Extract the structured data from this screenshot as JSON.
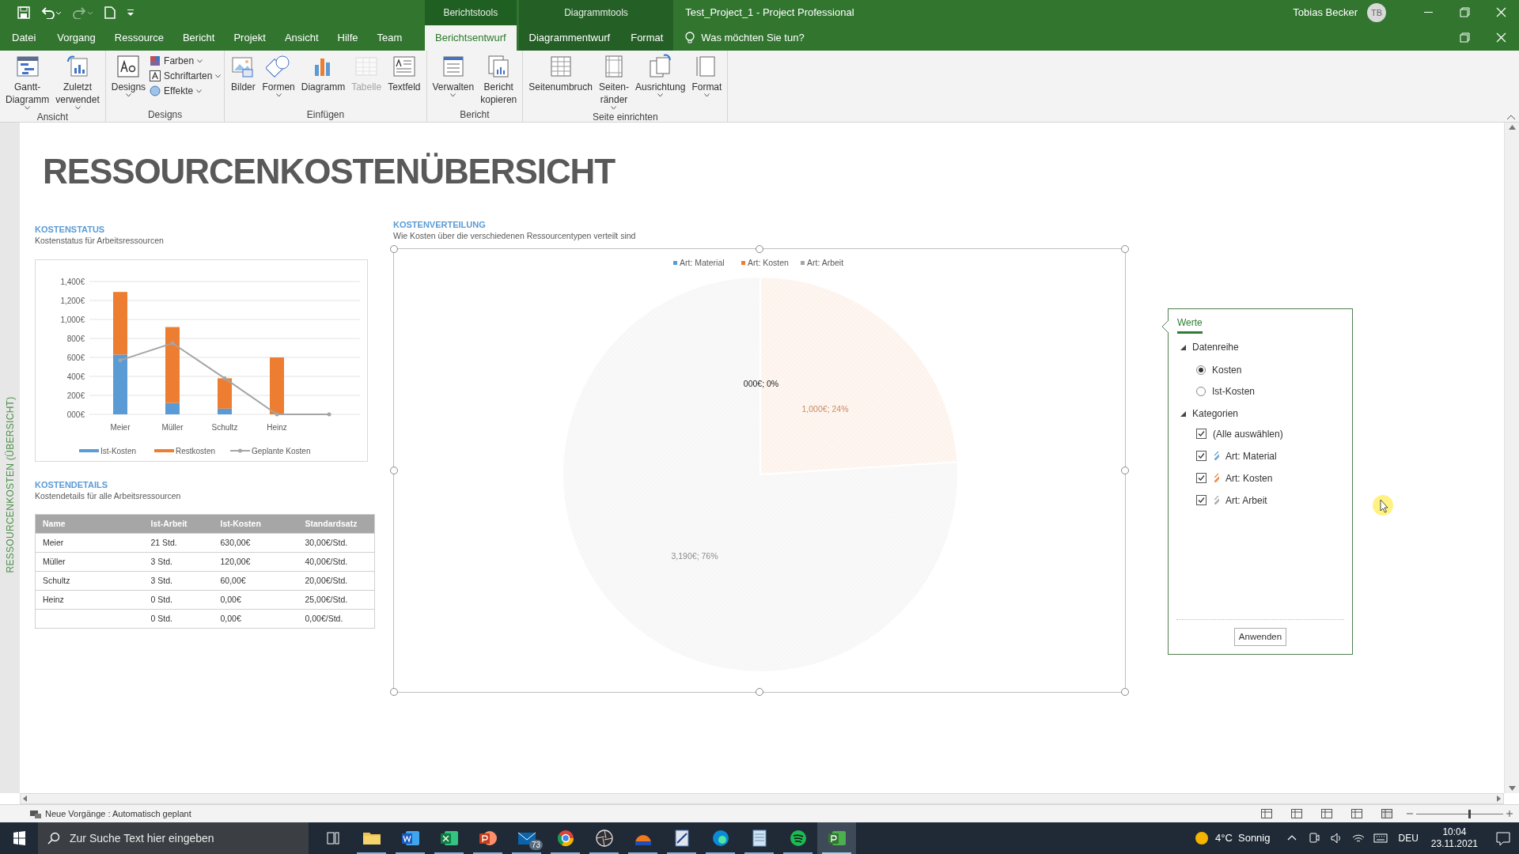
{
  "window": {
    "title": "Test_Project_1  -  Project Professional",
    "user": "Tobias Becker",
    "avatar": "TB"
  },
  "context_tabs": [
    {
      "label": "Berichtstools",
      "tabs": [
        {
          "label": "Berichtsentwurf",
          "selected": true
        }
      ]
    },
    {
      "label": "Diagrammtools",
      "tabs": [
        {
          "label": "Diagrammentwurf",
          "selected": false
        },
        {
          "label": "Format",
          "selected": false
        }
      ]
    }
  ],
  "tabs": [
    {
      "label": "Datei",
      "selected": false
    },
    {
      "label": "Vorgang",
      "selected": false
    },
    {
      "label": "Ressource",
      "selected": false
    },
    {
      "label": "Bericht",
      "selected": false
    },
    {
      "label": "Projekt",
      "selected": false
    },
    {
      "label": "Ansicht",
      "selected": false
    },
    {
      "label": "Hilfe",
      "selected": false
    },
    {
      "label": "Team",
      "selected": false
    }
  ],
  "tell_me": {
    "placeholder": "Was möchten Sie tun?"
  },
  "ribbon": [
    {
      "label": "Ansicht",
      "buttons": [
        {
          "kind": "large",
          "label": "Gantt-\nDiagramm",
          "dropdown": true,
          "disabled": false
        },
        {
          "kind": "large",
          "label": "Zuletzt\nverwendet",
          "dropdown": true,
          "disabled": false
        }
      ]
    },
    {
      "label": "Designs",
      "buttons": [
        {
          "kind": "large",
          "label": "Designs",
          "dropdown": true,
          "disabled": false
        },
        {
          "kind": "small",
          "label": "Farben",
          "dropdown": true,
          "disabled": false
        },
        {
          "kind": "small",
          "label": "Schriftarten",
          "dropdown": true,
          "disabled": false
        },
        {
          "kind": "small",
          "label": "Effekte",
          "dropdown": true,
          "disabled": false
        }
      ]
    },
    {
      "label": "Einfügen",
      "buttons": [
        {
          "kind": "large",
          "label": "Bilder",
          "dropdown": false,
          "disabled": false
        },
        {
          "kind": "large",
          "label": "Formen",
          "dropdown": true,
          "disabled": false
        },
        {
          "kind": "large",
          "label": "Diagramm",
          "dropdown": false,
          "disabled": false
        },
        {
          "kind": "large",
          "label": "Tabelle",
          "dropdown": false,
          "disabled": true
        },
        {
          "kind": "large",
          "label": "Textfeld",
          "dropdown": false,
          "disabled": false
        }
      ]
    },
    {
      "label": "Bericht",
      "buttons": [
        {
          "kind": "large",
          "label": "Verwalten",
          "dropdown": true,
          "disabled": false
        },
        {
          "kind": "large",
          "label": "Bericht\nkopieren",
          "dropdown": false,
          "disabled": false
        }
      ]
    },
    {
      "label": "Seite einrichten",
      "buttons": [
        {
          "kind": "large",
          "label": "Seitenumbruch",
          "dropdown": false,
          "disabled": false
        },
        {
          "kind": "large",
          "label": "Seiten-\nränder",
          "dropdown": true,
          "disabled": false
        },
        {
          "kind": "large",
          "label": "Ausrichtung",
          "dropdown": true,
          "disabled": false
        },
        {
          "kind": "large",
          "label": "Format",
          "dropdown": true,
          "disabled": false
        }
      ]
    }
  ],
  "report": {
    "side_label": "RESSOURCENKOSTEN (ÜBERSICHT)",
    "title": "RESSOURCENKOSTENÜBERSICHT",
    "cost_status": {
      "heading": "KOSTENSTATUS",
      "subtitle": "Kostenstatus für Arbeitsressourcen",
      "chart_data": {
        "type": "bar",
        "stacked": true,
        "categories": [
          "Meier",
          "Müller",
          "Schultz",
          "Heinz",
          null
        ],
        "series": [
          {
            "name": "Ist-Kosten",
            "type": "bar",
            "color": "#5b9bd5",
            "values": [
              630,
              120,
              60,
              0,
              0
            ]
          },
          {
            "name": "Restkosten",
            "type": "bar",
            "color": "#ed7d31",
            "values": [
              660,
              800,
              320,
              600,
              0
            ]
          },
          {
            "name": "Geplante Kosten",
            "type": "line",
            "color": "#a5a5a5",
            "values": [
              570,
              750,
              380,
              0,
              0
            ]
          }
        ],
        "ylim": [
          0,
          1400
        ],
        "grid": true,
        "legend": "bottom",
        "yticks": [
          {
            "value": 0,
            "label": "000€"
          },
          {
            "value": 200,
            "label": "200€"
          },
          {
            "value": 400,
            "label": "400€"
          },
          {
            "value": 600,
            "label": "600€"
          },
          {
            "value": 800,
            "label": "800€"
          },
          {
            "value": 1000,
            "label": "1,000€"
          },
          {
            "value": 1200,
            "label": "1,200€"
          },
          {
            "value": 1400,
            "label": "1,400€"
          }
        ]
      }
    },
    "cost_details": {
      "heading": "KOSTENDETAILS",
      "subtitle": "Kostendetails für alle Arbeitsressourcen",
      "columns": [
        "Name",
        "Ist-Arbeit",
        "Ist-Kosten",
        "Standardsatz"
      ],
      "rows": [
        [
          "Meier",
          "21 Std.",
          "630,00€",
          "30,00€/Std."
        ],
        [
          "Müller",
          "3 Std.",
          "120,00€",
          "40,00€/Std."
        ],
        [
          "Schultz",
          "3 Std.",
          "60,00€",
          "20,00€/Std."
        ],
        [
          "Heinz",
          "0 Std.",
          "0,00€",
          "25,00€/Std."
        ],
        [
          null,
          "0 Std.",
          "0,00€",
          "0,00€/Std."
        ]
      ]
    },
    "cost_distribution": {
      "heading": "KOSTENVERTEILUNG",
      "subtitle": "Wie Kosten über die verschiedenen Ressourcentypen verteilt sind",
      "chart_data": {
        "type": "pie",
        "categories": [
          "Art: Material",
          "Art: Kosten",
          "Art: Arbeit"
        ],
        "colors": [
          "#5b9bd5",
          "#ed7d31",
          "#a5a5a5"
        ],
        "values": [
          0,
          24,
          76
        ],
        "legend": "top",
        "value_labels": [
          "000€; 0%",
          "1,000€; 24%",
          "3,190€; 76%"
        ]
      }
    }
  },
  "filter_panel": {
    "tab": "Werte",
    "sections": [
      {
        "label": "Datenreihe",
        "kind": "radio",
        "expanded": true,
        "items": [
          {
            "label": "Kosten",
            "selected": true
          },
          {
            "label": "Ist-Kosten",
            "selected": false
          }
        ]
      },
      {
        "label": "Kategorien",
        "kind": "checkbox",
        "expanded": true,
        "items": [
          {
            "label": "(Alle auswählen)",
            "checked": true
          },
          {
            "label": "Art: Material",
            "checked": true,
            "color": "#5b9bd5"
          },
          {
            "label": "Art: Kosten",
            "checked": true,
            "color": "#ed7d31"
          },
          {
            "label": "Art: Arbeit",
            "checked": true,
            "color": "#a5a5a5"
          }
        ]
      }
    ],
    "button": "Anwenden"
  },
  "status_bar": {
    "text": "Neue Vorgänge : Automatisch geplant",
    "zoom": {
      "level": 0.6
    }
  },
  "taskbar": {
    "search": {
      "placeholder": "Zur Suche Text hier eingeben"
    },
    "apps": [
      {
        "running": false,
        "selected": false
      },
      {
        "running": true,
        "selected": false
      },
      {
        "running": true,
        "selected": false
      },
      {
        "running": true,
        "selected": false
      },
      {
        "running": true,
        "selected": false
      },
      {
        "running": true,
        "selected": false,
        "badge": "73"
      },
      {
        "running": true,
        "selected": false
      },
      {
        "running": true,
        "selected": false
      },
      {
        "running": true,
        "selected": false
      },
      {
        "running": true,
        "selected": false
      },
      {
        "running": true,
        "selected": false
      },
      {
        "running": true,
        "selected": false
      },
      {
        "running": true,
        "selected": false
      },
      {
        "running": true,
        "selected": true
      }
    ],
    "weather": "4°C  Sonnig",
    "language": "DEU",
    "time": "10:04",
    "date": "23.11.2021"
  }
}
